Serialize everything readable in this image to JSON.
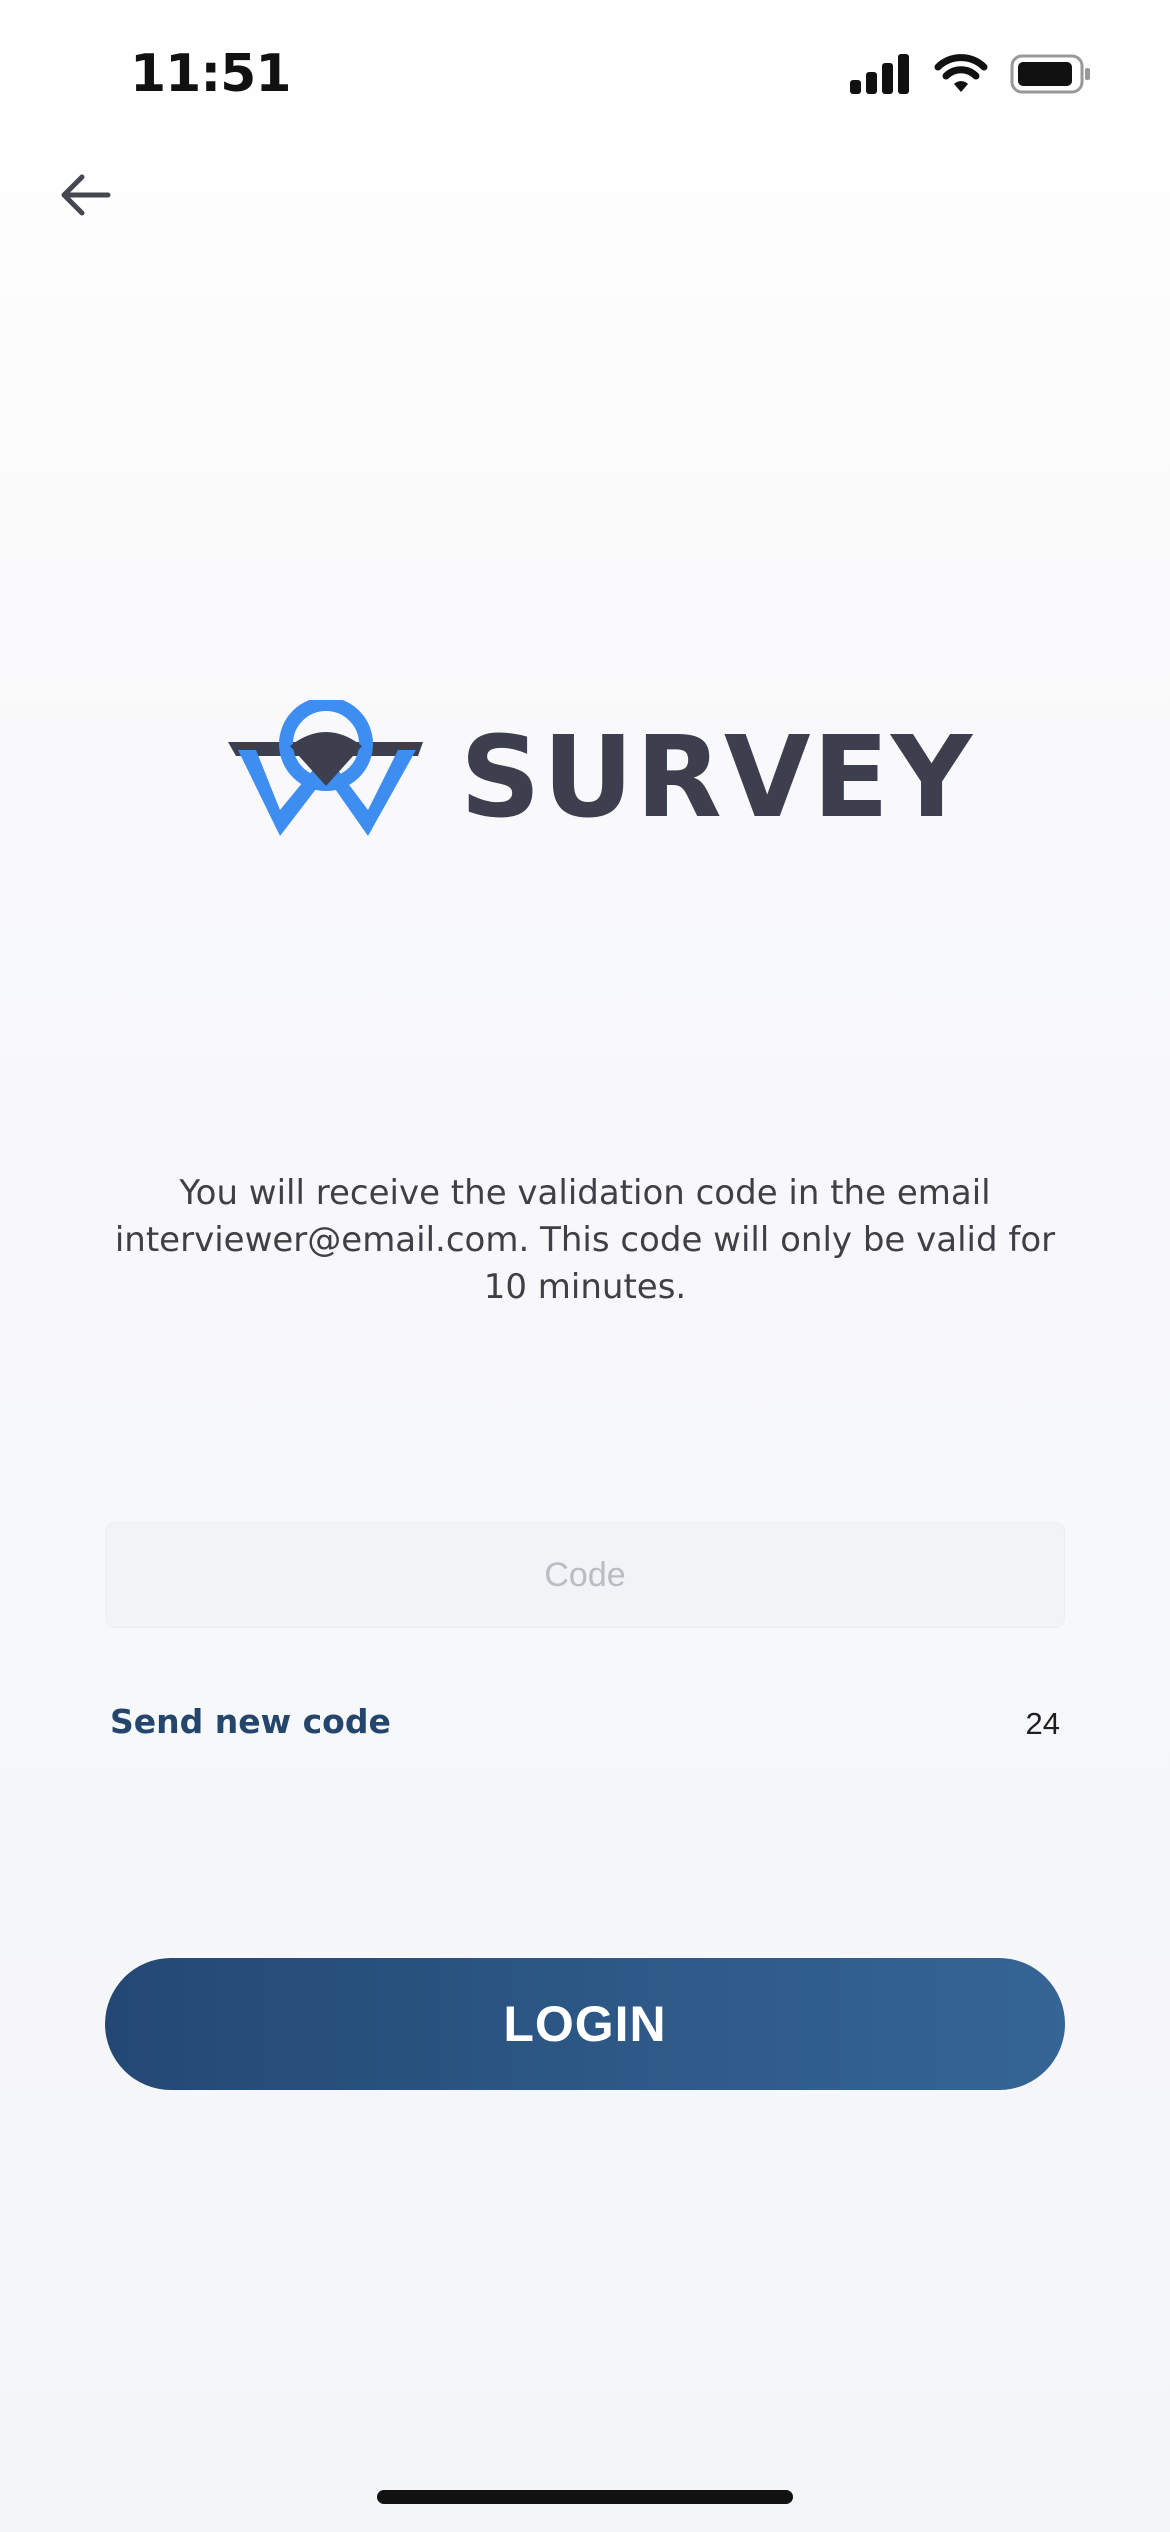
{
  "status_bar": {
    "time": "11:51"
  },
  "navigation": {
    "back_icon": "arrow-left-icon"
  },
  "logo": {
    "text": "SURVEY",
    "mark_icon": "survey-logo-icon",
    "colors": {
      "accent": "#3d8ef0",
      "dark": "#3d3f4f"
    }
  },
  "info": {
    "message": "You will receive the validation code in the email interviewer@email.com. This code will only be valid for 10 minutes."
  },
  "code_input": {
    "placeholder": "Code",
    "value": ""
  },
  "resend": {
    "label": "Send new code",
    "countdown": "24"
  },
  "login_button": {
    "label": "LOGIN",
    "colors": {
      "start": "#244873",
      "end": "#356594"
    }
  }
}
